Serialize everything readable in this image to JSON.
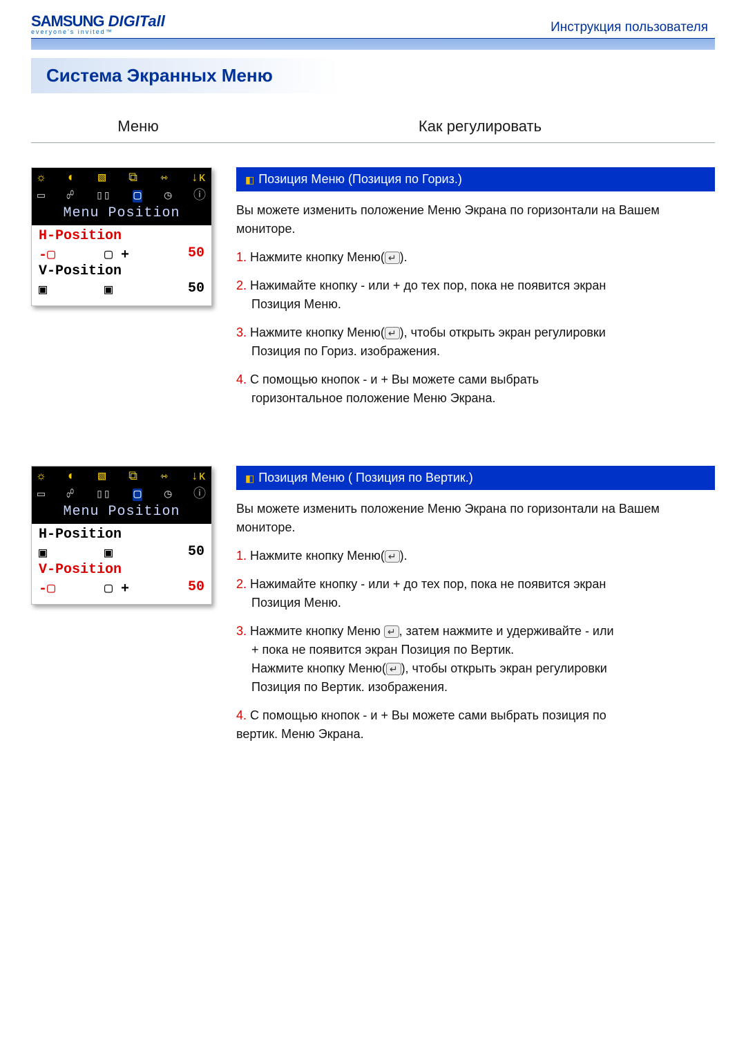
{
  "header": {
    "brand1": "SAMSUNG",
    "brand2": " DIGITall",
    "slogan": "everyone's invited™",
    "doctype": "Инструкция пользователя"
  },
  "section_title": "Система Экранных Меню",
  "subheaders": {
    "menu": "Меню",
    "howto": "Как регулировать"
  },
  "osd_common": {
    "title": "Menu Position",
    "h_label": "H-Position",
    "v_label": "V-Position",
    "value_h": "50",
    "value_v": "50"
  },
  "block1": {
    "title": "Позиция Меню (Позиция по Гориз.)",
    "intro": "Вы можете изменить положение Меню Экрана по горизонтали на Вашем мониторе.",
    "steps": [
      {
        "n": "1.",
        "text": "Нажмите кнопку Меню(",
        "enter": "↵",
        "tail": ")."
      },
      {
        "n": "2.",
        "text": "Нажимайте кнопку - или + до тех пор, пока не появится экран",
        "tail2": "Позиция Меню."
      },
      {
        "n": "3.",
        "text": "Нажмите кнопку Меню(",
        "enter": "↵",
        "tail": "), чтобы открыть экран регулировки",
        "tail2": "Позиция по Гориз. изображения."
      },
      {
        "n": "4.",
        "text": "С помощью кнопок - и + Вы можете сами выбрать",
        "tail2": "горизонтальное положение Меню Экрана."
      }
    ]
  },
  "block2": {
    "title": "Позиция Меню ( Позиция по Вертик.)",
    "intro": "Вы можете изменить положение Меню Экрана по горизонтали на Вашем мониторе.",
    "steps": [
      {
        "n": "1.",
        "text": "Нажмите кнопку Меню(",
        "enter": "↵",
        "tail": ")."
      },
      {
        "n": "2.",
        "text": "Нажимайте кнопку - или + до тех пор, пока не появится экран",
        "tail2": "Позиция Меню."
      },
      {
        "n": "3.",
        "text": "Нажмите кнопку Меню ",
        "enter": "↵",
        "tail": ", затем нажмите и удерживайте - или",
        "tail2": "+ пока не появится экран Позиция по Вертик.",
        "text3": "Нажмите кнопку Меню(",
        "enter3": "↵",
        "tail3": "), чтобы открыть экран регулировки",
        "tail4": "Позиция по Вертик. изображения."
      },
      {
        "n": "4.",
        "text": "С помощью кнопок - и + Вы можете сами выбрать позиция по",
        "tail_alt": "вертик. Меню Экрана."
      }
    ]
  },
  "icons": {
    "sun": "☼",
    "half": "◐",
    "arrow": "▧",
    "win": "⧉",
    "stretch": "⇿",
    "k": "↓ᴋ",
    "rect": "▭",
    "link": "☍",
    "bars": "▯▯",
    "sel": "▢",
    "clock": "◷",
    "info": "ⓘ",
    "h_left": "-▢",
    "h_right": "▢ +",
    "v_down": "▣",
    "v_up": "▣"
  }
}
